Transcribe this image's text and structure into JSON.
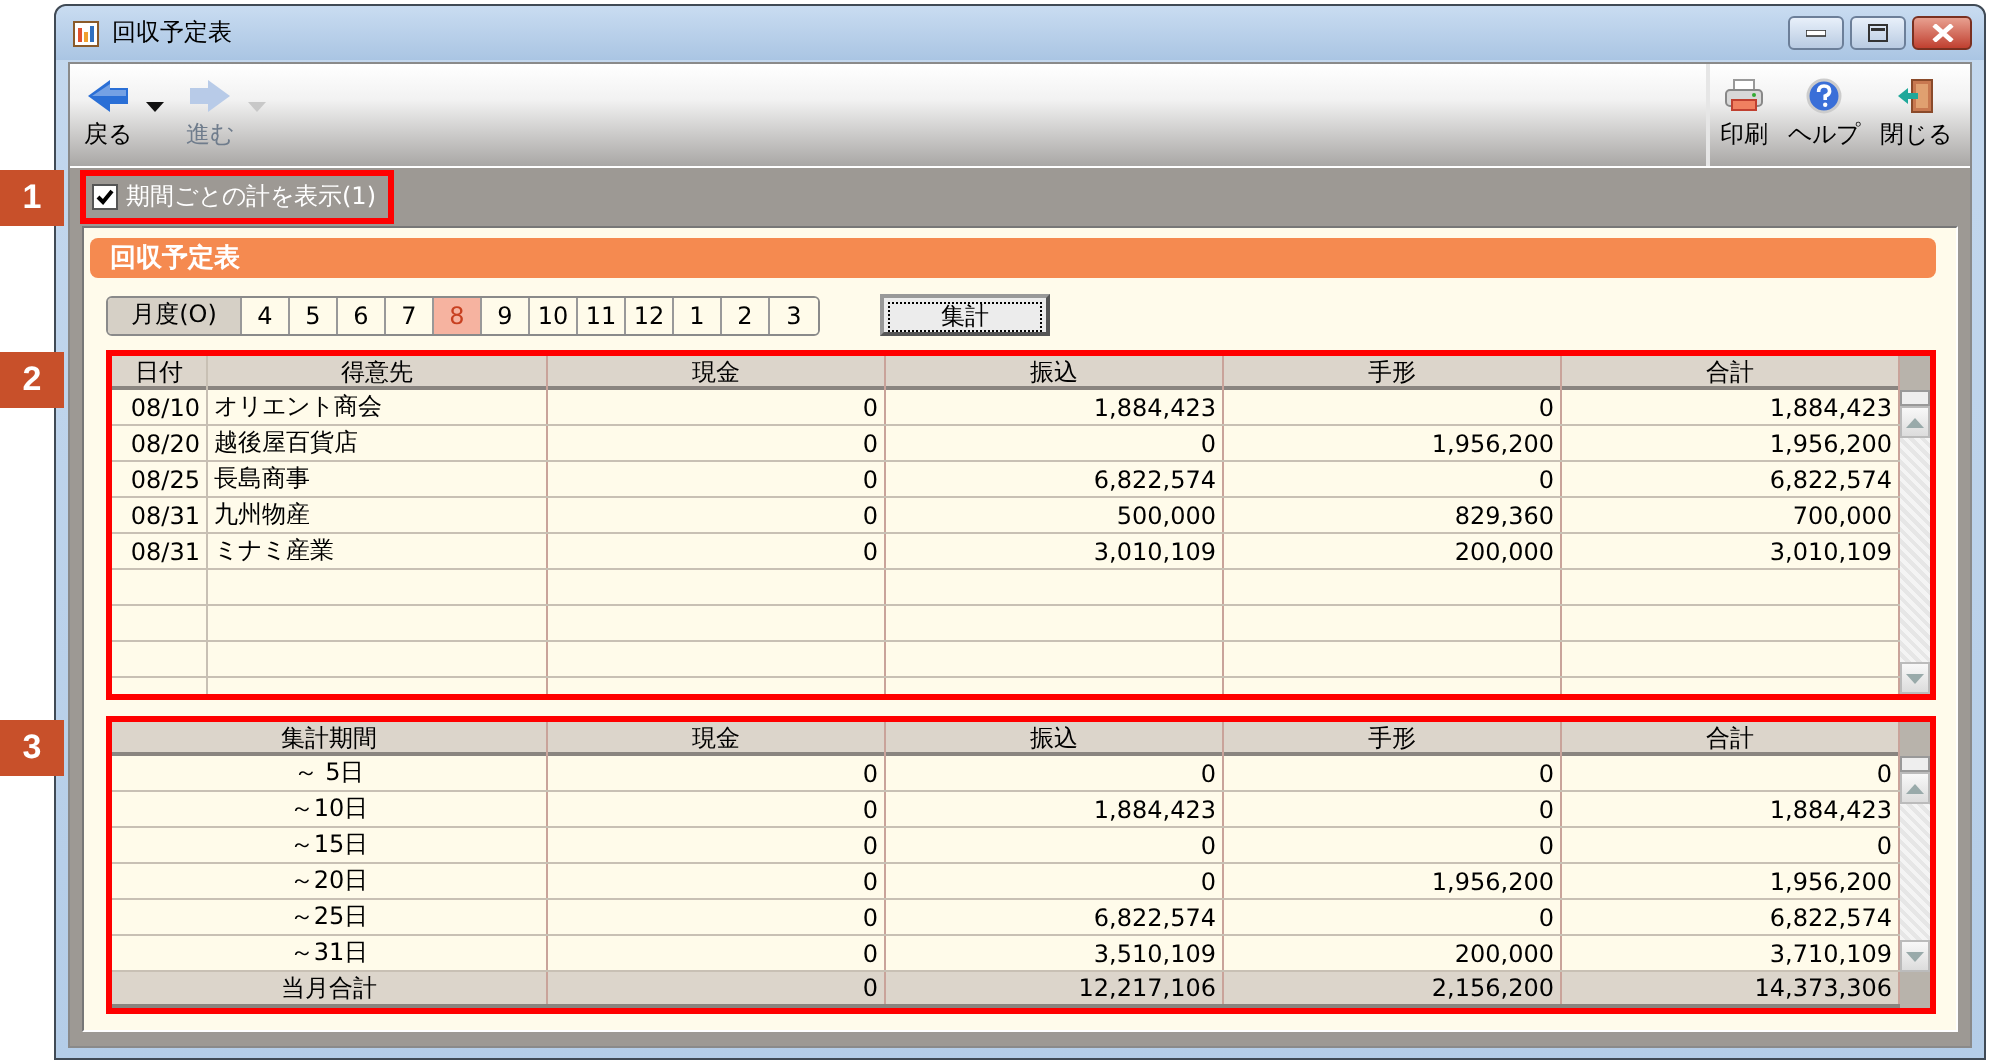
{
  "callouts": [
    "1",
    "2",
    "3"
  ],
  "window": {
    "title": "回収予定表"
  },
  "toolbar": {
    "left": [
      {
        "label": "戻る",
        "kind": "back",
        "disabled": false
      },
      {
        "label": "進む",
        "kind": "forward",
        "disabled": true
      }
    ],
    "right": [
      {
        "label": "印刷",
        "kind": "print"
      },
      {
        "label": "ヘルプ",
        "kind": "help"
      },
      {
        "label": "閉じる",
        "kind": "close"
      }
    ]
  },
  "options": {
    "show_period_totals": {
      "label": "期間ごとの計を表示(1)",
      "checked": true
    }
  },
  "panel": {
    "title": "回収予定表"
  },
  "months": {
    "label": "月度(O)",
    "items": [
      {
        "label": "4",
        "selected": false
      },
      {
        "label": "5",
        "selected": false
      },
      {
        "label": "6",
        "selected": false
      },
      {
        "label": "7",
        "selected": false
      },
      {
        "label": "8",
        "selected": true
      },
      {
        "label": "9",
        "selected": false
      },
      {
        "label": "10",
        "selected": false
      },
      {
        "label": "11",
        "selected": false
      },
      {
        "label": "12",
        "selected": false
      },
      {
        "label": "1",
        "selected": false
      },
      {
        "label": "2",
        "selected": false
      },
      {
        "label": "3",
        "selected": false
      }
    ]
  },
  "aggregate_button": "集計",
  "detail_table": {
    "columns": [
      "日付",
      "得意先",
      "現金",
      "振込",
      "手形",
      "合計"
    ],
    "rows": [
      [
        "08/10",
        "オリエント商会",
        "0",
        "1,884,423",
        "0",
        "1,884,423"
      ],
      [
        "08/20",
        "越後屋百貨店",
        "0",
        "0",
        "1,956,200",
        "1,956,200"
      ],
      [
        "08/25",
        "長島商事",
        "0",
        "6,822,574",
        "0",
        "6,822,574"
      ],
      [
        "08/31",
        "九州物産",
        "0",
        "500,000",
        "829,360",
        "700,000"
      ],
      [
        "08/31",
        "ミナミ産業",
        "0",
        "3,010,109",
        "200,000",
        "3,010,109"
      ]
    ]
  },
  "summary_table": {
    "columns": [
      "集計期間",
      "現金",
      "振込",
      "手形",
      "合計"
    ],
    "rows": [
      [
        "～ 5日",
        "0",
        "0",
        "0",
        "0"
      ],
      [
        "～10日",
        "0",
        "1,884,423",
        "0",
        "1,884,423"
      ],
      [
        "～15日",
        "0",
        "0",
        "0",
        "0"
      ],
      [
        "～20日",
        "0",
        "0",
        "1,956,200",
        "1,956,200"
      ],
      [
        "～25日",
        "0",
        "6,822,574",
        "0",
        "6,822,574"
      ],
      [
        "～31日",
        "0",
        "3,510,109",
        "200,000",
        "3,710,109"
      ]
    ],
    "total": [
      "当月合計",
      "0",
      "12,217,106",
      "2,156,200",
      "14,373,306"
    ]
  }
}
